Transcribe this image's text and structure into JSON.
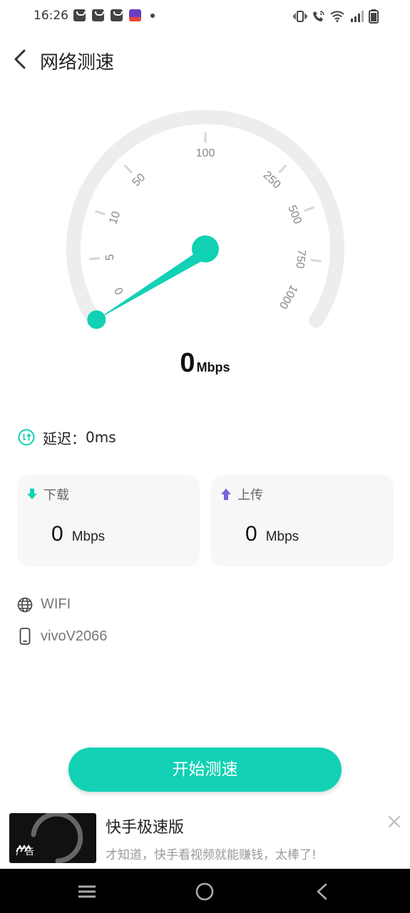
{
  "status_bar": {
    "time": "16:26"
  },
  "header": {
    "title": "网络测速"
  },
  "gauge": {
    "tick_labels": [
      "0",
      "5",
      "10",
      "50",
      "100",
      "250",
      "500",
      "750",
      "1000"
    ],
    "current_value": "0",
    "unit": "Mbps",
    "accent_color": "#12d1b4",
    "track_color": "#ededed"
  },
  "latency": {
    "label": "延迟：",
    "value": "0ms"
  },
  "download": {
    "title": "下载",
    "value": "0",
    "unit": "Mbps"
  },
  "upload": {
    "title": "上传",
    "value": "0",
    "unit": "Mbps"
  },
  "network": {
    "type": "WIFI",
    "device": "vivoV2066"
  },
  "start_button": {
    "label": "开始测速"
  },
  "ad": {
    "tag": "广告",
    "title": "快手极速版",
    "description": "才知道，快手看视频就能赚钱，太棒了!"
  },
  "colors": {
    "accent": "#12d1b4",
    "upload_icon": "#7b5fe0"
  }
}
